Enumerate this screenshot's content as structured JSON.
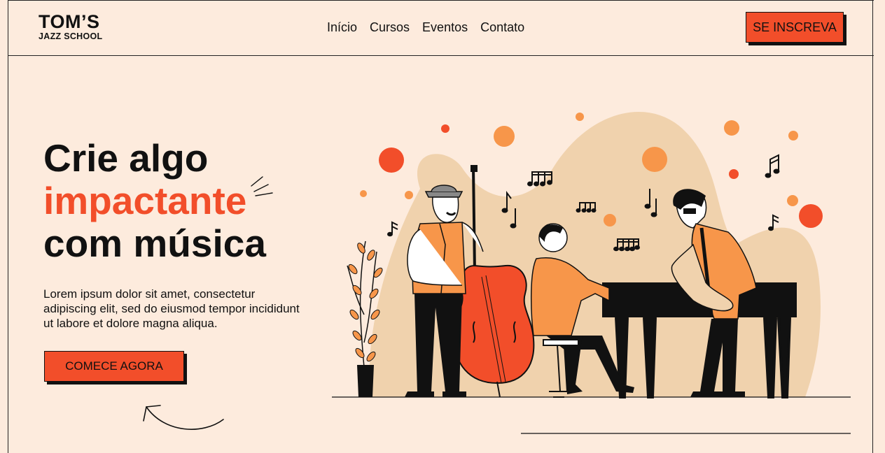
{
  "brand": {
    "name": "TOM’S",
    "subtitle": "JAZZ SCHOOL"
  },
  "nav": {
    "items": [
      {
        "label": "Início"
      },
      {
        "label": "Cursos"
      },
      {
        "label": "Eventos"
      },
      {
        "label": "Contato"
      }
    ]
  },
  "header": {
    "signup_label": "SE INSCREVA"
  },
  "hero": {
    "title_line1": "Crie algo",
    "title_line2": "impactante",
    "title_line3": "com música",
    "text": "Lorem ipsum dolor sit amet, consectetur adipiscing elit, sed do eiusmod tempor incididunt ut labore et dolore magna aliqua.",
    "cta_label": "COMECE AGORA"
  },
  "colors": {
    "background": "#fdebdd",
    "accent": "#f24e2a",
    "orange": "#f7964a",
    "beige": "#f0d2ad"
  },
  "icons": [
    "music-note-icon",
    "arrow-curved-icon",
    "sparkle-lines-icon"
  ]
}
